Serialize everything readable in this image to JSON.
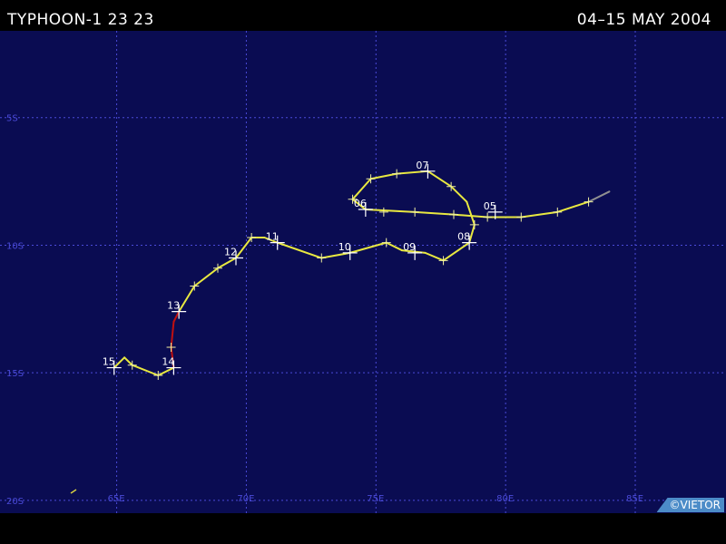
{
  "header": {
    "title": "TYPHOON-1 23 23",
    "date_range": "04–15 MAY 2004"
  },
  "credit": "©VIETOR",
  "colors": {
    "ocean": "#0a0c52",
    "grid": "#4a4ad8",
    "track_storm": "#e8e840",
    "track_typhoon": "#c01010",
    "track_depression": "#909090"
  },
  "map": {
    "lon_range": [
      60.5,
      88.5
    ],
    "lat_range": [
      -1.6,
      -20.5
    ],
    "lon_ticks": [
      65,
      70,
      75,
      80,
      85
    ],
    "lat_ticks": [
      -5,
      -10,
      -15,
      -20
    ],
    "lon_labels": [
      "65E",
      "70E",
      "75E",
      "80E",
      "85E"
    ],
    "lat_labels": [
      "5S",
      "10S",
      "15S",
      "20S"
    ]
  },
  "track": [
    {
      "lon": 84.0,
      "lat": -7.9,
      "intensity": "depression"
    },
    {
      "lon": 83.2,
      "lat": -8.3,
      "intensity": "storm"
    },
    {
      "lon": 82.0,
      "lat": -8.7,
      "intensity": "storm"
    },
    {
      "lon": 80.6,
      "lat": -8.9,
      "intensity": "storm"
    },
    {
      "lon": 79.3,
      "lat": -8.9,
      "intensity": "storm"
    },
    {
      "lon": 78.0,
      "lat": -8.8,
      "intensity": "storm"
    },
    {
      "lon": 76.5,
      "lat": -8.7,
      "intensity": "storm"
    },
    {
      "lon": 74.6,
      "lat": -8.6,
      "intensity": "storm"
    },
    {
      "lon": 74.1,
      "lat": -8.2,
      "intensity": "storm"
    },
    {
      "lon": 74.8,
      "lat": -7.4,
      "intensity": "storm"
    },
    {
      "lon": 75.8,
      "lat": -7.2,
      "intensity": "storm"
    },
    {
      "lon": 77.0,
      "lat": -7.1,
      "intensity": "storm"
    },
    {
      "lon": 77.9,
      "lat": -7.7,
      "intensity": "storm"
    },
    {
      "lon": 78.5,
      "lat": -8.3,
      "intensity": "storm"
    },
    {
      "lon": 78.8,
      "lat": -9.2,
      "intensity": "storm"
    },
    {
      "lon": 78.6,
      "lat": -9.9,
      "intensity": "storm"
    },
    {
      "lon": 77.6,
      "lat": -10.6,
      "intensity": "storm"
    },
    {
      "lon": 76.9,
      "lat": -10.3,
      "intensity": "storm"
    },
    {
      "lon": 76.0,
      "lat": -10.2,
      "intensity": "storm"
    },
    {
      "lon": 75.4,
      "lat": -9.9,
      "intensity": "storm"
    },
    {
      "lon": 74.0,
      "lat": -10.3,
      "intensity": "storm"
    },
    {
      "lon": 72.9,
      "lat": -10.5,
      "intensity": "storm"
    },
    {
      "lon": 71.2,
      "lat": -9.9,
      "intensity": "storm"
    },
    {
      "lon": 70.7,
      "lat": -9.7,
      "intensity": "storm"
    },
    {
      "lon": 70.2,
      "lat": -9.7,
      "intensity": "storm"
    },
    {
      "lon": 69.6,
      "lat": -10.5,
      "intensity": "storm"
    },
    {
      "lon": 68.9,
      "lat": -10.9,
      "intensity": "storm"
    },
    {
      "lon": 68.0,
      "lat": -11.6,
      "intensity": "storm"
    },
    {
      "lon": 67.4,
      "lat": -12.6,
      "intensity": "storm"
    },
    {
      "lon": 67.2,
      "lat": -13.0,
      "intensity": "typhoon"
    },
    {
      "lon": 67.1,
      "lat": -14.0,
      "intensity": "typhoon"
    },
    {
      "lon": 67.2,
      "lat": -14.8,
      "intensity": "typhoon"
    },
    {
      "lon": 66.6,
      "lat": -15.1,
      "intensity": "storm"
    },
    {
      "lon": 65.6,
      "lat": -14.7,
      "intensity": "storm"
    },
    {
      "lon": 65.3,
      "lat": -14.4,
      "intensity": "storm"
    },
    {
      "lon": 64.9,
      "lat": -14.8,
      "intensity": "storm"
    }
  ],
  "ticks": [
    {
      "lon": 83.2,
      "lat": -8.3
    },
    {
      "lon": 82.0,
      "lat": -8.7
    },
    {
      "lon": 80.6,
      "lat": -8.9
    },
    {
      "lon": 79.3,
      "lat": -8.9
    },
    {
      "lon": 78.0,
      "lat": -8.8
    },
    {
      "lon": 76.5,
      "lat": -8.7
    },
    {
      "lon": 75.3,
      "lat": -8.7
    },
    {
      "lon": 74.1,
      "lat": -8.2
    },
    {
      "lon": 74.8,
      "lat": -7.4
    },
    {
      "lon": 75.8,
      "lat": -7.2
    },
    {
      "lon": 77.9,
      "lat": -7.7
    },
    {
      "lon": 78.8,
      "lat": -9.2
    },
    {
      "lon": 77.6,
      "lat": -10.6
    },
    {
      "lon": 75.4,
      "lat": -9.9
    },
    {
      "lon": 72.9,
      "lat": -10.5
    },
    {
      "lon": 70.2,
      "lat": -9.7
    },
    {
      "lon": 68.9,
      "lat": -10.9
    },
    {
      "lon": 68.0,
      "lat": -11.6
    },
    {
      "lon": 67.1,
      "lat": -14.0
    },
    {
      "lon": 66.6,
      "lat": -15.1
    },
    {
      "lon": 65.6,
      "lat": -14.7
    }
  ],
  "day_markers": [
    {
      "label": "05",
      "lon": 79.6,
      "lat": -8.7
    },
    {
      "label": "06",
      "lon": 74.6,
      "lat": -8.6
    },
    {
      "label": "07",
      "lon": 77.0,
      "lat": -7.1
    },
    {
      "label": "08",
      "lon": 78.6,
      "lat": -9.9
    },
    {
      "label": "09",
      "lon": 76.5,
      "lat": -10.3
    },
    {
      "label": "10",
      "lon": 74.0,
      "lat": -10.3
    },
    {
      "label": "11",
      "lon": 71.2,
      "lat": -9.9
    },
    {
      "label": "12",
      "lon": 69.6,
      "lat": -10.5
    },
    {
      "label": "13",
      "lon": 67.4,
      "lat": -12.6
    },
    {
      "label": "14",
      "lon": 67.2,
      "lat": -14.8
    },
    {
      "label": "15",
      "lon": 64.9,
      "lat": -14.8
    }
  ]
}
